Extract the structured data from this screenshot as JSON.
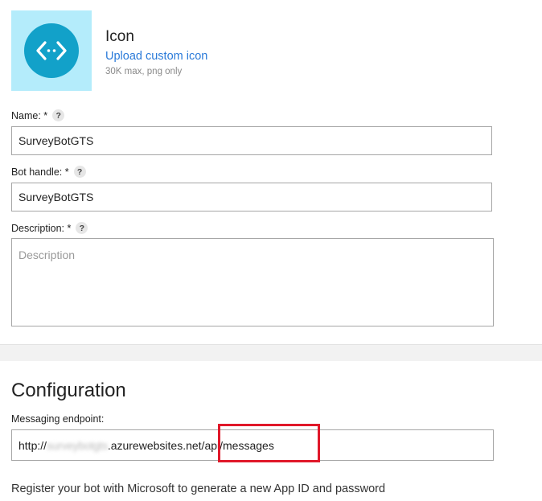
{
  "icon": {
    "icon_name": "code-brackets-icon",
    "tile_color": "#b4ecfb",
    "circle_color": "#12a1c9",
    "title": "Icon",
    "upload_link": "Upload custom icon",
    "hint": "30K max, png only"
  },
  "fields": {
    "name": {
      "label": "Name: *",
      "help": "?",
      "value": "SurveyBotGTS"
    },
    "handle": {
      "label": "Bot handle: *",
      "help": "?",
      "value": "SurveyBotGTS"
    },
    "description": {
      "label": "Description: *",
      "help": "?",
      "value": "",
      "placeholder": "Description"
    }
  },
  "configuration": {
    "title": "Configuration",
    "endpoint_label": "Messaging endpoint:",
    "endpoint_prefix": "http://",
    "endpoint_redacted": "surveybotgts",
    "endpoint_host": ".azurewebsites.net/",
    "endpoint_path": "api/messages",
    "highlight_color": "#e0182a"
  },
  "footer": {
    "text": "Register your bot with Microsoft to generate a new App ID and password"
  }
}
